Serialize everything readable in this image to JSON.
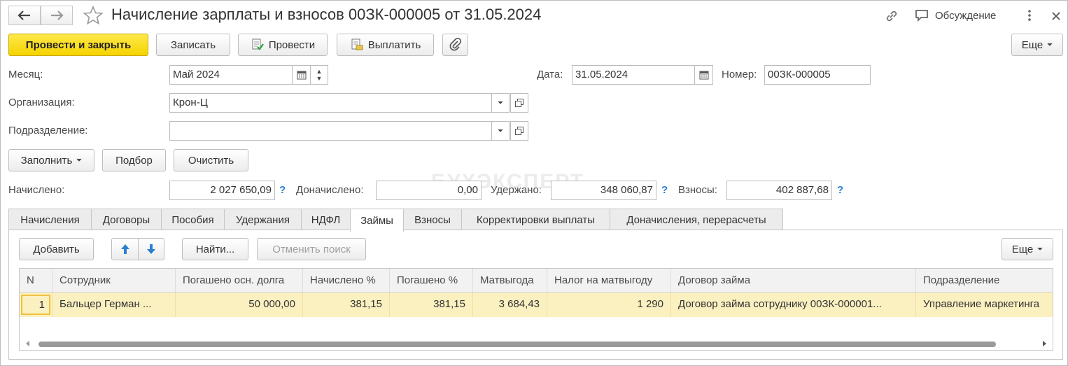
{
  "window": {
    "title": "Начисление зарплаты и взносов 00ЗК-000005 от 31.05.2024",
    "discuss_label": "Обсуждение"
  },
  "toolbar": {
    "post_close": "Провести и закрыть",
    "save": "Записать",
    "post": "Провести",
    "pay": "Выплатить",
    "more": "Еще"
  },
  "form": {
    "month_label": "Месяц:",
    "month_value": "Май 2024",
    "date_label": "Дата:",
    "date_value": "31.05.2024",
    "number_label": "Номер:",
    "number_value": "00ЗК-000005",
    "org_label": "Организация:",
    "org_value": "Крон-Ц",
    "dept_label": "Подразделение:",
    "dept_value": ""
  },
  "actions": {
    "fill": "Заполнить",
    "select": "Подбор",
    "clear": "Очистить"
  },
  "totals": {
    "accrued_label": "Начислено:",
    "accrued_value": "2 027 650,09",
    "extra_label": "Доначислено:",
    "extra_value": "0,00",
    "withheld_label": "Удержано:",
    "withheld_value": "348 060,87",
    "contrib_label": "Взносы:",
    "contrib_value": "402 887,68",
    "help": "?"
  },
  "watermark": "БУХЭКСПЕРТ",
  "tabs": [
    {
      "label": "Начисления"
    },
    {
      "label": "Договоры"
    },
    {
      "label": "Пособия"
    },
    {
      "label": "Удержания"
    },
    {
      "label": "НДФЛ"
    },
    {
      "label": "Займы"
    },
    {
      "label": "Взносы"
    },
    {
      "label": "Корректировки выплаты"
    },
    {
      "label": "Доначисления, перерасчеты"
    }
  ],
  "active_tab": "Займы",
  "table_toolbar": {
    "add": "Добавить",
    "find": "Найти...",
    "cancel_search": "Отменить поиск",
    "more": "Еще"
  },
  "table": {
    "columns": [
      "N",
      "Сотрудник",
      "Погашено осн. долга",
      "Начислено %",
      "Погашено %",
      "Матвыгода",
      "Налог на матвыгоду",
      "Договор займа",
      "Подразделение"
    ],
    "rows": [
      [
        "1",
        "Бальцер Герман ...",
        "50 000,00",
        "381,15",
        "381,15",
        "3 684,43",
        "1 290",
        "Договор займа сотруднику 00ЗК-000001...",
        "Управление маркетинга"
      ]
    ]
  },
  "colors": {
    "primary_button": "#f5d400",
    "selected_row": "#fbf0c0",
    "help_icon": "#2b7fd1",
    "arrow_icon": "#2b7fd1"
  }
}
